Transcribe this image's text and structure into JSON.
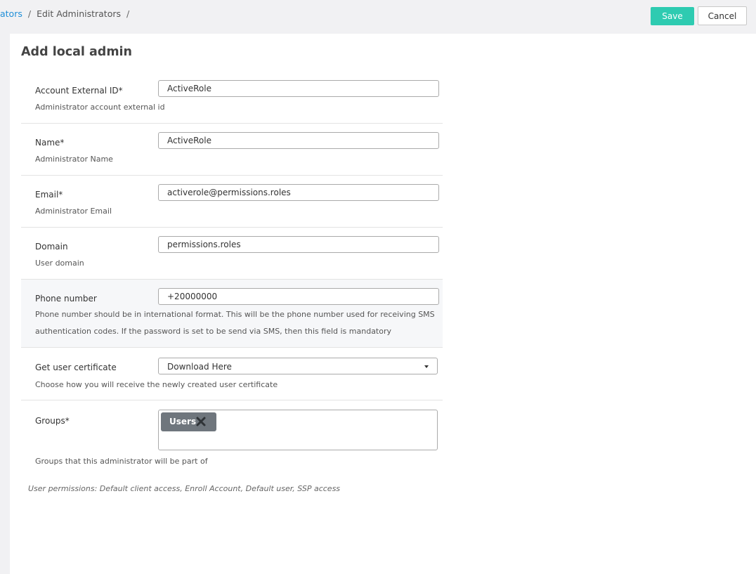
{
  "breadcrumb": {
    "link": "ators",
    "separator": "/",
    "current": "Edit Administrators"
  },
  "toolbar": {
    "save_label": "Save",
    "cancel_label": "Cancel",
    "accent_color": "#2ecbb1"
  },
  "page": {
    "title": "Add local admin"
  },
  "form": {
    "account_id": {
      "label": "Account External ID*",
      "description": "Administrator account external id",
      "value": "ActiveRole"
    },
    "name": {
      "label": "Name*",
      "description": "Administrator Name",
      "value": "ActiveRole"
    },
    "email": {
      "label": "Email*",
      "description": "Administrator Email",
      "value": "activerole@permissions.roles"
    },
    "domain": {
      "label": "Domain",
      "description": "User domain",
      "value": "permissions.roles"
    },
    "phone": {
      "label": "Phone number",
      "description": "Phone number should be in international format. This will be the phone number used for receiving SMS authentication codes. If the password is set to be send via SMS, then this field is mandatory",
      "value": "+20000000"
    },
    "certificate": {
      "label": "Get user certificate",
      "description": "Choose how you will receive the newly created user certificate",
      "selected": "Download Here"
    },
    "groups": {
      "label": "Groups*",
      "description": "Groups that this administrator will be part of",
      "tags": [
        "Users"
      ]
    }
  },
  "permissions_note": "User permissions: Default client access, Enroll Account, Default user, SSP access",
  "icons": {
    "remove_tag": "close-icon",
    "dropdown": "chevron-down-icon"
  }
}
